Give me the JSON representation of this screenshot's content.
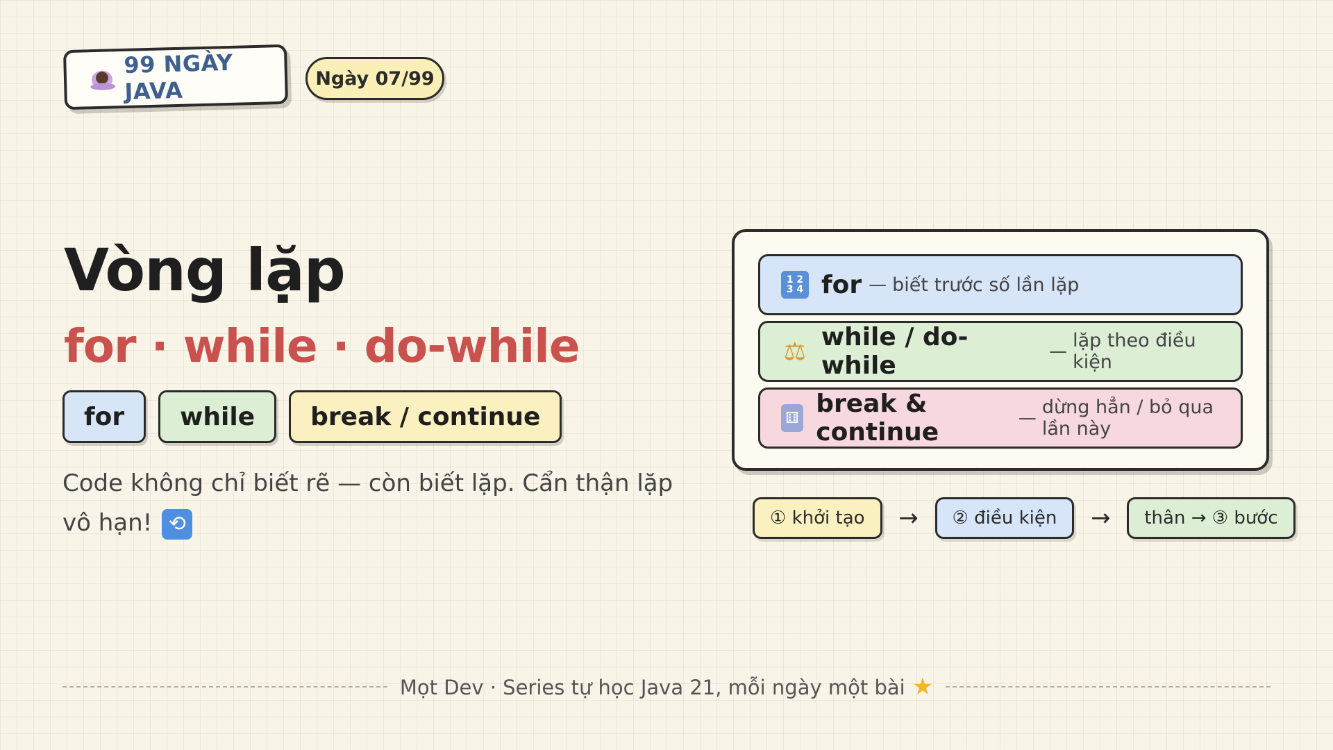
{
  "header": {
    "series_label": "99 NGÀY JAVA",
    "day_label": "Ngày 07/99"
  },
  "main": {
    "title": "Vòng lặp",
    "subtitle": "for · while · do-while",
    "chips": [
      "for",
      "while",
      "break / continue"
    ],
    "description": "Code không chỉ biết rẽ — còn biết lặp. Cẩn thận lặp vô hạn!"
  },
  "card": {
    "rows": [
      {
        "icon": "numbers-1234-icon",
        "keyword": "for",
        "note": "biết trước số lần lặp"
      },
      {
        "icon": "balance-scale-icon",
        "keyword": "while / do-while",
        "note": "lặp theo điều kiện"
      },
      {
        "icon": "dice-icon",
        "keyword": "break & continue",
        "note": "dừng hẳn / bỏ qua lần này"
      }
    ],
    "separator": "—"
  },
  "flow": {
    "steps": [
      "① khởi tạo",
      "② điều kiện",
      "thân → ③ bước"
    ],
    "arrow": "→"
  },
  "footer": {
    "text": "Mọt Dev · Series tự học Java 21, mỗi ngày một bài"
  },
  "colors": {
    "accent_red": "#c9514e",
    "series_blue": "#3f5f8f",
    "chip_blue": "#d6e6f7",
    "chip_green": "#dcefd5",
    "chip_yellow": "#fbf0c0",
    "row_pink": "#f7d8df"
  }
}
